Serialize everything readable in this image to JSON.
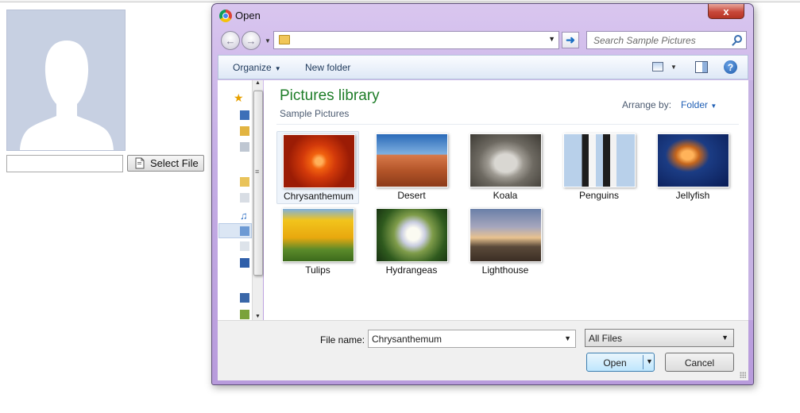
{
  "page": {
    "select_file_label": "Select File",
    "file_input_value": ""
  },
  "dialog": {
    "title": "Open",
    "close_glyph": "x",
    "search_placeholder": "Search Sample Pictures",
    "toolbar": {
      "organize": "Organize",
      "new_folder": "New folder"
    },
    "library": {
      "title": "Pictures library",
      "subtitle": "Sample Pictures",
      "arrange_label": "Arrange by:",
      "arrange_value": "Folder"
    },
    "items": [
      {
        "label": "Chrysanthemum",
        "selected": true
      },
      {
        "label": "Desert"
      },
      {
        "label": "Koala"
      },
      {
        "label": "Penguins"
      },
      {
        "label": "Jellyfish"
      },
      {
        "label": "Tulips"
      },
      {
        "label": "Hydrangeas"
      },
      {
        "label": "Lighthouse"
      }
    ],
    "footer": {
      "file_name_label": "File name:",
      "file_name_value": "Chrysanthemum",
      "filter_value": "All Files",
      "open_label": "Open",
      "cancel_label": "Cancel"
    }
  },
  "colors": {
    "library_title": "#1e7d28",
    "link_blue": "#1f5fb5",
    "window_frame": "#c5aee5"
  }
}
